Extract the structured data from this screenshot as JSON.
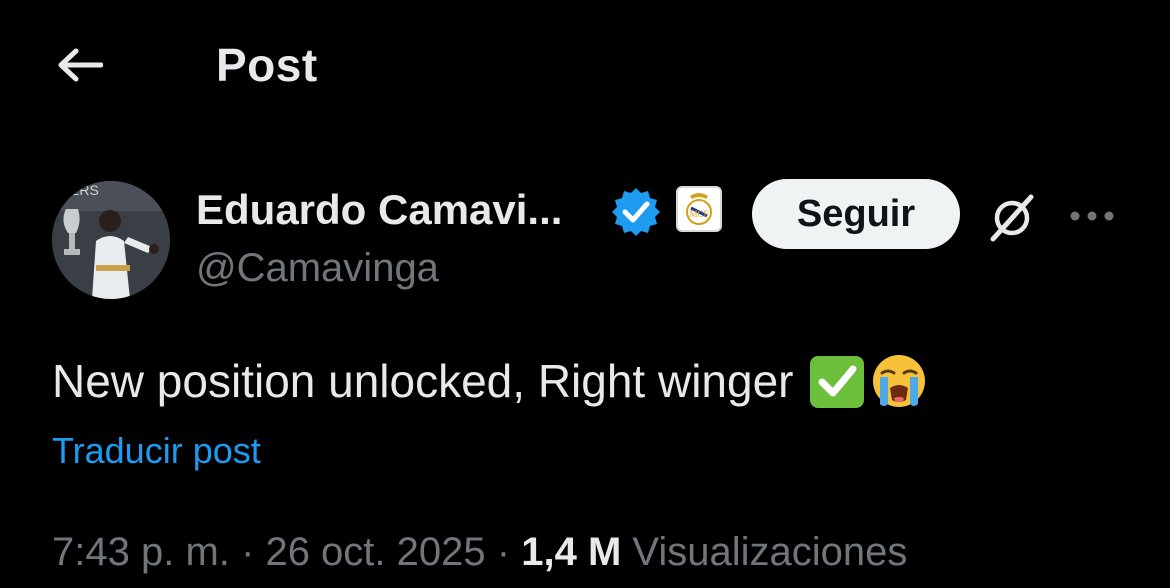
{
  "header": {
    "back_icon": "arrow-left-icon",
    "title": "Post"
  },
  "author": {
    "name": "Eduardo Camavi...",
    "handle": "@Camavinga",
    "verified_icon": "verified-badge-icon",
    "affiliate_icon": "real-madrid-crest-icon",
    "avatar_text": "ERS"
  },
  "actions": {
    "follow_label": "Seguir",
    "grok_icon": "grok-icon",
    "more_icon": "more-horizontal-icon"
  },
  "post": {
    "text": "New position unlocked, Right winger",
    "emojis": [
      "check-mark-button-emoji",
      "loudly-crying-face-emoji"
    ],
    "translate_label": "Traducir post"
  },
  "meta": {
    "time": "7:43 p. m.",
    "separator": "·",
    "date": "26 oct. 2025",
    "views_count": "1,4 M",
    "views_label": "Visualizaciones"
  },
  "colors": {
    "background": "#000000",
    "primary_text": "#e7e9ea",
    "secondary_text": "#71767b",
    "link": "#1d9bf0",
    "verified": "#1d9bf0"
  }
}
